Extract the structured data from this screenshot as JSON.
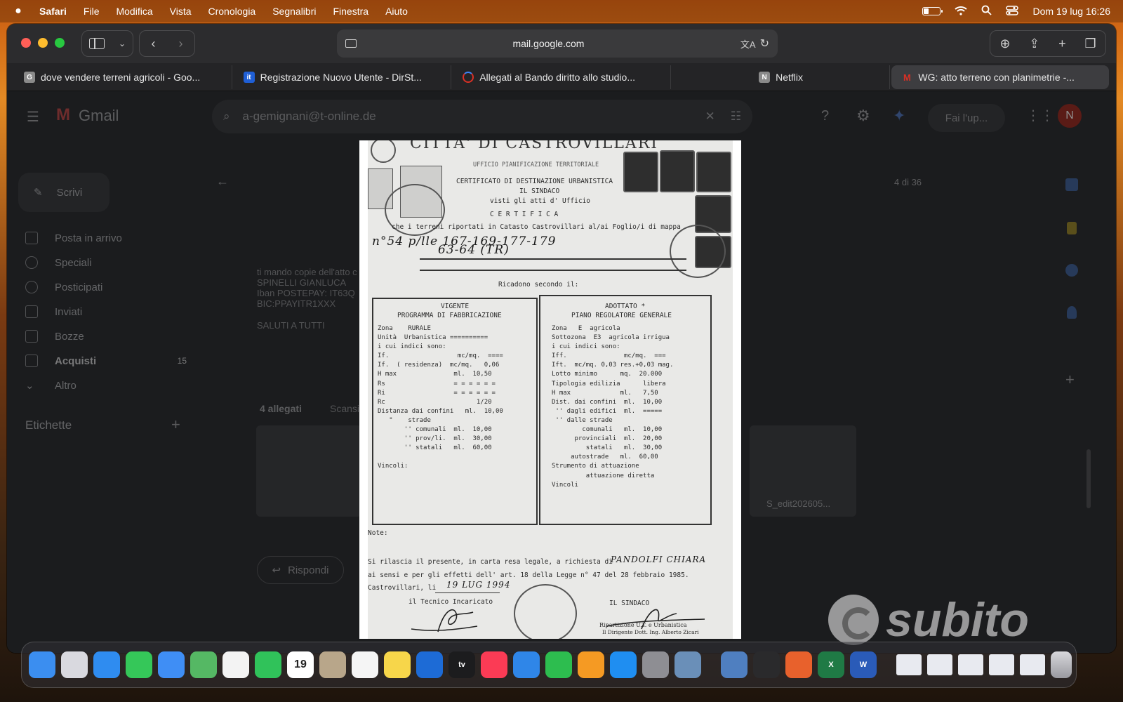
{
  "menubar": {
    "app": "Safari",
    "items": [
      "File",
      "Modifica",
      "Vista",
      "Cronologia",
      "Segnalibri",
      "Finestra",
      "Aiuto"
    ],
    "clock": "Dom 19 lug  16:26",
    "battery_level": 0.35
  },
  "safari": {
    "url": "mail.google.com",
    "tabs": [
      {
        "title": "dove vendere terreni agricoli - Goo...",
        "favicon": "G",
        "color": "#8a8a8a"
      },
      {
        "title": "Registrazione Nuovo Utente - DirSt...",
        "favicon": "it",
        "color": "#1f5fd6"
      },
      {
        "title": "Allegati al Bando diritto allo studio...",
        "favicon": "",
        "color": "#d93025"
      },
      {
        "title": "Netflix",
        "favicon": "N",
        "color": "#8a8a8a"
      },
      {
        "title": "WG: atto terreno con planimetrie -...",
        "favicon": "M",
        "color": "#d93025"
      }
    ]
  },
  "gmail": {
    "logo_text": "Gmail",
    "search_query": "a-gemignani@t-online.de",
    "compose_label": "Scrivi",
    "nav": [
      {
        "label": "Posta in arrivo",
        "bold": false
      },
      {
        "label": "Speciali",
        "bold": false
      },
      {
        "label": "Posticipati",
        "bold": false
      },
      {
        "label": "Inviati",
        "bold": false
      },
      {
        "label": "Bozze",
        "bold": false
      },
      {
        "label": "Acquisti",
        "bold": true,
        "count": "15"
      },
      {
        "label": "Altro",
        "bold": false
      }
    ],
    "labels_heading": "Etichette",
    "pagination": "4 di 36",
    "cta": "Fai l'up...",
    "avatar_initial": "N",
    "body_lines": [
      "ti mando copie dell'atto c",
      "SPINELLI GIANLUCA",
      "Iban POSTEPAY: IT63Q",
      "BIC:PPAYITR1XXX",
      "SALUTI A TUTTI"
    ],
    "attachments_label": "4 allegati",
    "scan_label": "Scansio",
    "attachment_filename": "S_edit202605...",
    "reply_label": "Rispondi"
  },
  "document": {
    "heading": "CITTA' DI CASTROVILLARI",
    "office": "UFFICIO PIANIFICAZIONE TERRITORIALE",
    "title": "CERTIFICATO DI DESTINAZIONE URBANISTICA",
    "mayor": "IL SINDACO",
    "seen": "visti gli atti d' Ufficio",
    "certifica": "C E R T I F I C A",
    "intro": "che i terreni riportati in Catasto Castrovillari al/ai Foglio/i di mappa",
    "handwritten_1": "n°54  p/lle  167-169-177-179",
    "handwritten_2": "63-64 (TR)",
    "fall_under": "Ricadono secondo il:",
    "left_box": {
      "title1": "VIGENTE",
      "title2": "PROGRAMMA DI FABBRICAZIONE",
      "lines": [
        "Zona    RURALE",
        "Unità  Urbanistica ==========",
        "i cui indici sono:",
        "If.                  mc/mq.  ====",
        "If.  ( residenza)  mc/mq.   0,06",
        "H max               ml.  10,50",
        "Rs                  = = = = = =",
        "Ri                  = = = = = =",
        "Rc                        1/20",
        "Distanza dai confini   ml.  10,00",
        "   \"    strade",
        "       '' comunali  ml.  10,00",
        "       '' prov/li.  ml.  30,00",
        "       '' statali   ml.  60,00",
        "",
        "Vincoli:"
      ]
    },
    "right_box": {
      "title1": "ADOTTATO *",
      "title2": "PIANO REGOLATORE GENERALE",
      "lines": [
        "Zona   E  agricola",
        "Sottozona  E3  agricola irrigua",
        "i cui indici sono:",
        "Iff.               mc/mq.  ===",
        "Ift.  mc/mq. 0,03 res.+0,03 mag.",
        "Lotto minimo      mq.  20.000",
        "Tipologia edilizia      libera",
        "H max             ml.   7,50",
        "Dist. dai confini  ml.  10,00",
        " '' dagli edifici  ml.  =====",
        " '' dalle strade",
        "        comunali   ml.  10,00",
        "      provinciali  ml.  20,00",
        "         statali   ml.  30,00",
        "     autostrade   ml.  60,00",
        "Strumento di attuazione",
        "         attuazione diretta",
        "Vincoli"
      ]
    },
    "note": "Note:",
    "issued": "Si rilascia il presente, in carta resa legale, a richiesta di",
    "applicant": "PANDOLFI  CHIARA",
    "law": "ai sensi e per gli effetti dell' art. 18 della Legge n° 47 del 28 febbraio 1985.",
    "place_date": "Castrovillari, li",
    "date_stamp": "19 LUG 1994",
    "technician": "il Tecnico Incaricato",
    "mayor_sign": "IL  SINDACO",
    "signature_block_1": "Ripartizione U.T. e Urbanistica",
    "signature_block_2": "Il Dirigente Dott. Ing. Alberto Zicari"
  },
  "watermark": "subito",
  "dock": {
    "apps": [
      {
        "name": "finder-icon",
        "color": "#3b8ef0",
        "label": ""
      },
      {
        "name": "launchpad-icon",
        "color": "#d9d9df",
        "label": ""
      },
      {
        "name": "safari-icon",
        "color": "#2f8cf0",
        "label": ""
      },
      {
        "name": "messages-icon",
        "color": "#35c759",
        "label": ""
      },
      {
        "name": "mail-icon",
        "color": "#3f8ef5",
        "label": ""
      },
      {
        "name": "maps-icon",
        "color": "#55b864",
        "label": ""
      },
      {
        "name": "photos-icon",
        "color": "#f3f3f3",
        "label": ""
      },
      {
        "name": "facetime-icon",
        "color": "#30c25a",
        "label": ""
      },
      {
        "name": "calendar-icon",
        "color": "#ffffff",
        "label": "19"
      },
      {
        "name": "contacts-icon",
        "color": "#b8a68a",
        "label": ""
      },
      {
        "name": "reminders-icon",
        "color": "#f5f5f5",
        "label": ""
      },
      {
        "name": "notes-icon",
        "color": "#f7d64a",
        "label": ""
      },
      {
        "name": "freeform-icon",
        "color": "#1d6bd6",
        "label": ""
      },
      {
        "name": "tv-icon",
        "color": "#1c1c1e",
        "label": "tv"
      },
      {
        "name": "music-icon",
        "color": "#fb3b55",
        "label": ""
      },
      {
        "name": "keynote-icon",
        "color": "#2f86e8",
        "label": ""
      },
      {
        "name": "numbers-icon",
        "color": "#2dbd4f",
        "label": ""
      },
      {
        "name": "pages-icon",
        "color": "#f59a23",
        "label": ""
      },
      {
        "name": "app-store-icon",
        "color": "#1f8ef1",
        "label": ""
      },
      {
        "name": "system-settings-icon",
        "color": "#8e8e93",
        "label": ""
      },
      {
        "name": "preview-icon",
        "color": "#6a8fb8",
        "label": ""
      },
      {
        "name": "disk-utility-icon",
        "color": "#4f7fc0",
        "label": ""
      },
      {
        "name": "activity-monitor-icon",
        "color": "#2a2a2c",
        "label": ""
      },
      {
        "name": "firefox-icon",
        "color": "#e8612c",
        "label": ""
      },
      {
        "name": "excel-icon",
        "color": "#1f7a45",
        "label": "X"
      },
      {
        "name": "word-icon",
        "color": "#2a5bb8",
        "label": "W"
      }
    ],
    "recent": [
      "doc-thumb-1",
      "doc-thumb-2",
      "doc-thumb-3",
      "doc-thumb-4",
      "doc-thumb-5"
    ]
  }
}
